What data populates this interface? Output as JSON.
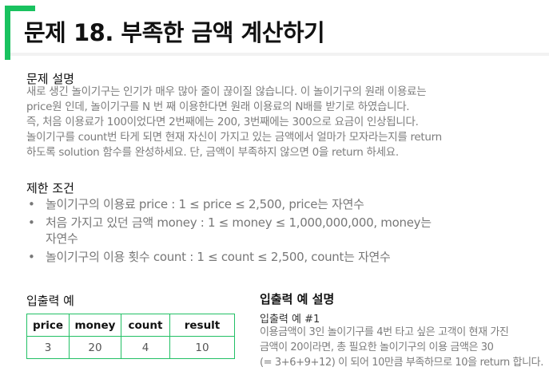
{
  "title": "문제 18. 부족한 금액 계산하기",
  "description": {
    "heading": "문제 설명",
    "lines": [
      "새로 생긴 놀이기구는 인기가 매우 많아 줄이 끊이질 않습니다. 이 놀이기구의 원래 이용료는",
      "price원 인데, 놀이기구를 N 번 째 이용한다면 원래 이용료의 N배를 받기로 하였습니다.",
      "즉, 처음 이용료가 100이었다면 2번째에는 200, 3번째에는 300으로 요금이 인상됩니다.",
      "놀이기구를 count번 타게 되면 현재 자신이 가지고 있는 금액에서 얼마가 모자라는지를 return",
      "하도록 solution 함수를 완성하세요. 단, 금액이 부족하지 않으면 0을 return 하세요."
    ]
  },
  "constraints": {
    "heading": "제한 조건",
    "bullet": "•",
    "items": [
      {
        "line1": "놀이기구의 이용료 price : 1 ≤ price ≤ 2,500, price는 자연수",
        "line2": ""
      },
      {
        "line1": "처음 가지고 있던 금액 money : 1 ≤ money ≤ 1,000,000,000, money는",
        "line2": "자연수"
      },
      {
        "line1": "놀이기구의 이용 횟수 count : 1 ≤ count ≤ 2,500, count는 자연수",
        "line2": ""
      }
    ]
  },
  "io": {
    "heading": "입출력 예",
    "headers": [
      "price",
      "money",
      "count",
      "result"
    ],
    "rows": [
      [
        "3",
        "20",
        "4",
        "10"
      ]
    ]
  },
  "explanation": {
    "heading": "입출력 예 설명",
    "subheading": "입출력 예 #1",
    "lines": [
      "이용금액이 3인 놀이기구를 4번 타고 싶은 고객이 현재 가진",
      "금액이 20이라면, 총 필요한 놀이기구의 이용 금액은 30",
      "(= 3+6+9+12) 이 되어 10만큼 부족하므로 10을 return 합니다."
    ]
  },
  "colors": {
    "accent": "#19c25f",
    "table_border": "#22c065"
  }
}
